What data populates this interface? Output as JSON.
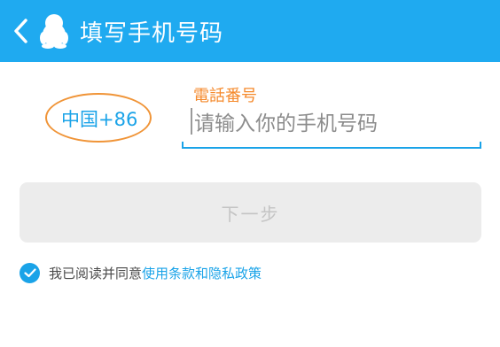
{
  "header": {
    "title": "填写手机号码",
    "back_icon": "chevron-left-icon",
    "logo_icon": "qq-penguin-icon",
    "background_color": "#1faaf0"
  },
  "phone": {
    "country_code": "中国+86",
    "placeholder": "请输入你的手机号码",
    "value": ""
  },
  "annotation": {
    "label": "電話番号",
    "color": "#f58a2c"
  },
  "next_button": {
    "label": "下一步"
  },
  "agreement": {
    "checked": true,
    "text": "我已阅读并同意",
    "link": "使用条款和隐私政策"
  },
  "colors": {
    "accent": "#1aa3e8",
    "disabled_button_bg": "#ececec",
    "disabled_button_text": "#c4c4c4"
  }
}
